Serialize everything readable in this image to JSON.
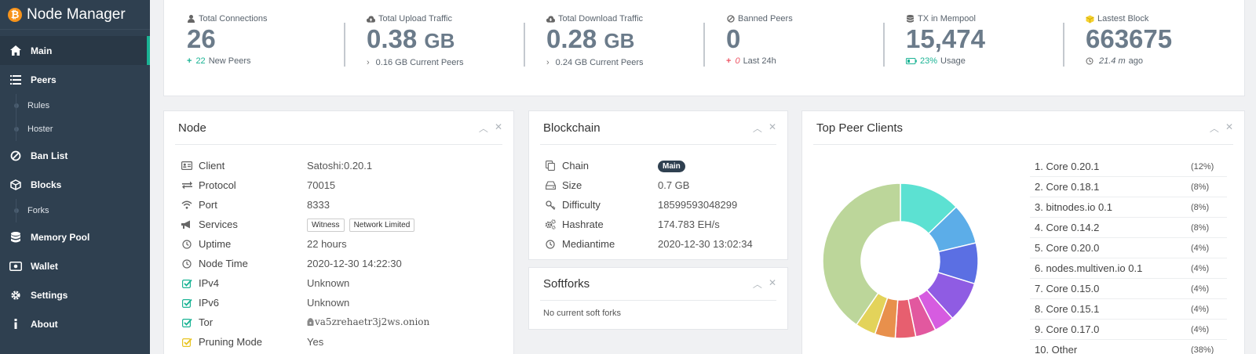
{
  "app": {
    "title": "Node Manager",
    "logo_glyph": "₿"
  },
  "sidebar": {
    "items": [
      {
        "label": "Main",
        "icon": "home-icon",
        "active": true
      },
      {
        "label": "Peers",
        "icon": "list-icon",
        "subitems": [
          "Rules",
          "Hoster"
        ]
      },
      {
        "label": "Ban List",
        "icon": "ban-icon"
      },
      {
        "label": "Blocks",
        "icon": "cube-icon",
        "subitems": [
          "Forks"
        ]
      },
      {
        "label": "Memory Pool",
        "icon": "database-icon"
      },
      {
        "label": "Wallet",
        "icon": "wallet-icon"
      },
      {
        "label": "Settings",
        "icon": "gear-icon"
      },
      {
        "label": "About",
        "icon": "info-icon"
      }
    ]
  },
  "stats": [
    {
      "label": "Total Connections",
      "icon": "user-icon",
      "value": "26",
      "unit": "",
      "sub_num": "22",
      "sub_text": "New Peers",
      "sub_prefix": "+"
    },
    {
      "label": "Total Upload Traffic",
      "icon": "cloud-upload-icon",
      "value": "0.38",
      "unit": "GB",
      "sub_num": "",
      "sub_text": "0.16 GB Current Peers",
      "sub_prefix": "›"
    },
    {
      "label": "Total Download Traffic",
      "icon": "cloud-download-icon",
      "value": "0.28",
      "unit": "GB",
      "sub_num": "",
      "sub_text": "0.24 GB Current Peers",
      "sub_prefix": "›"
    },
    {
      "label": "Banned Peers",
      "icon": "ban-icon",
      "value": "0",
      "unit": "",
      "sub_num": "0",
      "sub_text": "Last 24h",
      "sub_prefix": "+"
    },
    {
      "label": "TX in Mempool",
      "icon": "database-icon",
      "value": "15,474",
      "unit": "",
      "sub_num": "23%",
      "sub_text": "Usage",
      "sub_prefix": "battery"
    },
    {
      "label": "Lastest Block",
      "icon": "cube-icon",
      "value": "663675",
      "unit": "",
      "sub_num": "21.4 m",
      "sub_text": "ago",
      "sub_prefix": "clock"
    }
  ],
  "node_panel": {
    "title": "Node",
    "rows": [
      {
        "key": "Client",
        "icon": "id-card-icon",
        "value": "Satoshi:0.20.1"
      },
      {
        "key": "Protocol",
        "icon": "exchange-icon",
        "value": "70015"
      },
      {
        "key": "Port",
        "icon": "wifi-icon",
        "value": "8333"
      },
      {
        "key": "Services",
        "icon": "bullhorn-icon",
        "tags": [
          "Witness",
          "Network Limited"
        ]
      },
      {
        "key": "Uptime",
        "icon": "clock-icon",
        "value": "22 hours"
      },
      {
        "key": "Node Time",
        "icon": "clock-icon",
        "value": "2020-12-30 14:22:30"
      },
      {
        "key": "IPv4",
        "icon": "check-icon",
        "value": "Unknown"
      },
      {
        "key": "IPv6",
        "icon": "check-icon",
        "value": "Unknown"
      },
      {
        "key": "Tor",
        "icon": "check-icon",
        "value": "va5zrehaetr3j2ws.onion"
      },
      {
        "key": "Pruning Mode",
        "icon": "check-icon",
        "value": "Yes"
      }
    ]
  },
  "blockchain_panel": {
    "title": "Blockchain",
    "rows": [
      {
        "key": "Chain",
        "icon": "copy-icon",
        "badge": "Main"
      },
      {
        "key": "Size",
        "icon": "hdd-icon",
        "value": "0.7 GB"
      },
      {
        "key": "Difficulty",
        "icon": "key-icon",
        "value": "18599593048299"
      },
      {
        "key": "Hashrate",
        "icon": "cogs-icon",
        "value": "174.783 EH/s"
      },
      {
        "key": "Mediantime",
        "icon": "clock-icon",
        "value": "2020-12-30 13:02:34"
      }
    ]
  },
  "softforks_panel": {
    "title": "Softforks",
    "message": "No current soft forks"
  },
  "clients_panel": {
    "title": "Top Peer Clients"
  },
  "chart_data": {
    "type": "pie",
    "categories": [
      "Core 0.20.1",
      "Core 0.18.1",
      "bitnodes.io 0.1",
      "Core 0.14.2",
      "Core 0.20.0",
      "nodes.multiven.io 0.1",
      "Core 0.15.0",
      "Core 0.15.1",
      "Core 0.17.0",
      "Other"
    ],
    "labels": [
      "1. Core 0.20.1",
      "2. Core 0.18.1",
      "3. bitnodes.io 0.1",
      "4. Core 0.14.2",
      "5. Core 0.20.0",
      "6. nodes.multiven.io 0.1",
      "7. Core 0.15.0",
      "8. Core 0.15.1",
      "9. Core 0.17.0",
      "10. Other"
    ],
    "percent_labels": [
      "(12%)",
      "(8%)",
      "(8%)",
      "(8%)",
      "(4%)",
      "(4%)",
      "(4%)",
      "(4%)",
      "(4%)",
      "(38%)"
    ],
    "slice_values": [
      12,
      8,
      8,
      8,
      4,
      4,
      4,
      4,
      4,
      38
    ],
    "colors": [
      "#5ce1d2",
      "#5cade8",
      "#5b6fe3",
      "#8f5ce3",
      "#d65ce0",
      "#e2589f",
      "#e75f6f",
      "#e8904c",
      "#e3d35a",
      "#bcd69a"
    ]
  }
}
